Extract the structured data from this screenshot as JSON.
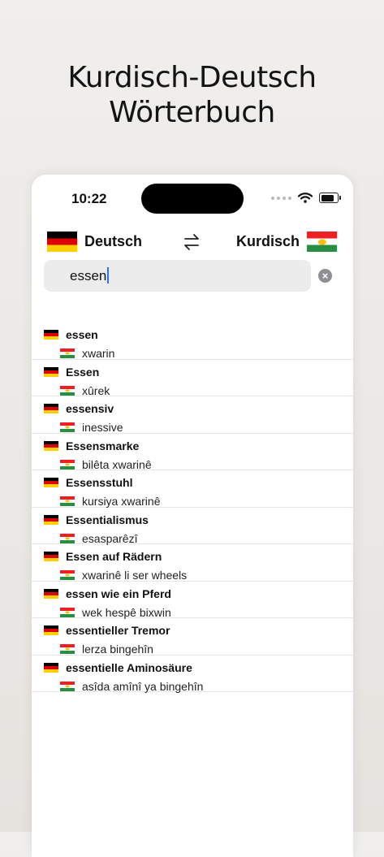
{
  "promo": {
    "title_line1": "Kurdisch-Deutsch",
    "title_line2": "Wörterbuch"
  },
  "status_bar": {
    "time": "10:22",
    "icons": [
      "signal-dots-icon",
      "wifi-icon",
      "battery-icon"
    ]
  },
  "language_bar": {
    "source_label": "Deutsch",
    "source_flag": "german-flag-icon",
    "target_label": "Kurdisch",
    "target_flag": "kurdish-flag-icon",
    "swap_icon": "swap-arrows-icon"
  },
  "search": {
    "value": "essen",
    "clear_icon": "clear-icon"
  },
  "results": [
    {
      "de": "essen",
      "ku": "xwarin"
    },
    {
      "de": "Essen",
      "ku": "xûrek"
    },
    {
      "de": "essensiv",
      "ku": "inessive"
    },
    {
      "de": "Essensmarke",
      "ku": "bilêta xwarinê"
    },
    {
      "de": "Essensstuhl",
      "ku": "kursiya xwarinê"
    },
    {
      "de": "Essentialismus",
      "ku": "esasparêzî"
    },
    {
      "de": "Essen auf Rädern",
      "ku": "xwarinê li ser wheels"
    },
    {
      "de": "essen wie ein Pferd",
      "ku": "wek hespê bixwin"
    },
    {
      "de": "essentieller Tremor",
      "ku": "lerza bingehîn"
    },
    {
      "de": "essentielle Aminosäure",
      "ku": "asîda amînî ya bingehîn"
    }
  ],
  "colors": {
    "german_flag": [
      "#000000",
      "#dd0000",
      "#ffce00"
    ],
    "kurdish_flag": [
      "#ed2024",
      "#ffffff",
      "#278e43",
      "#fcbf09"
    ],
    "caret": "#2f6fe8"
  }
}
